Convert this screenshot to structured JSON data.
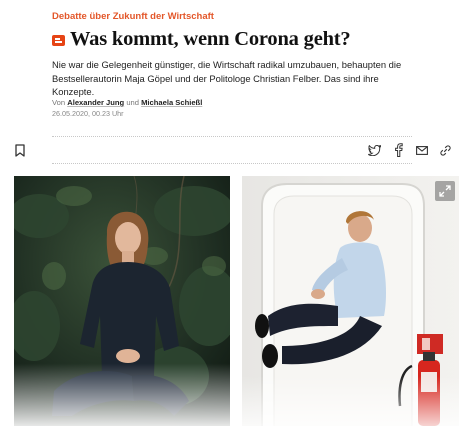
{
  "article": {
    "kicker": "Debatte über Zukunft der Wirtschaft",
    "title": "Was kommt, wenn Corona geht?",
    "lead": "Nie war die Gelegenheit günstiger, die Wirtschaft radikal umzubauen, behaupten die Bestsellerautorin Maja Göpel und der Politologe Christian Felber. Das sind ihre Konzepte.",
    "byline_prefix": "Von",
    "author_1": "Alexander Jung",
    "byline_and": "und",
    "author_2": "Michaela Schießl",
    "date": "26.05.2020, 00.23 Uhr"
  },
  "toolbar": {
    "icons": [
      "bookmark-icon",
      "twitter-icon",
      "facebook-icon",
      "mail-icon",
      "link-icon"
    ]
  },
  "media": {
    "icons": [
      "expand-icon"
    ]
  },
  "colors": {
    "accent": "#e3572a",
    "plus_badge": "#e64415"
  }
}
